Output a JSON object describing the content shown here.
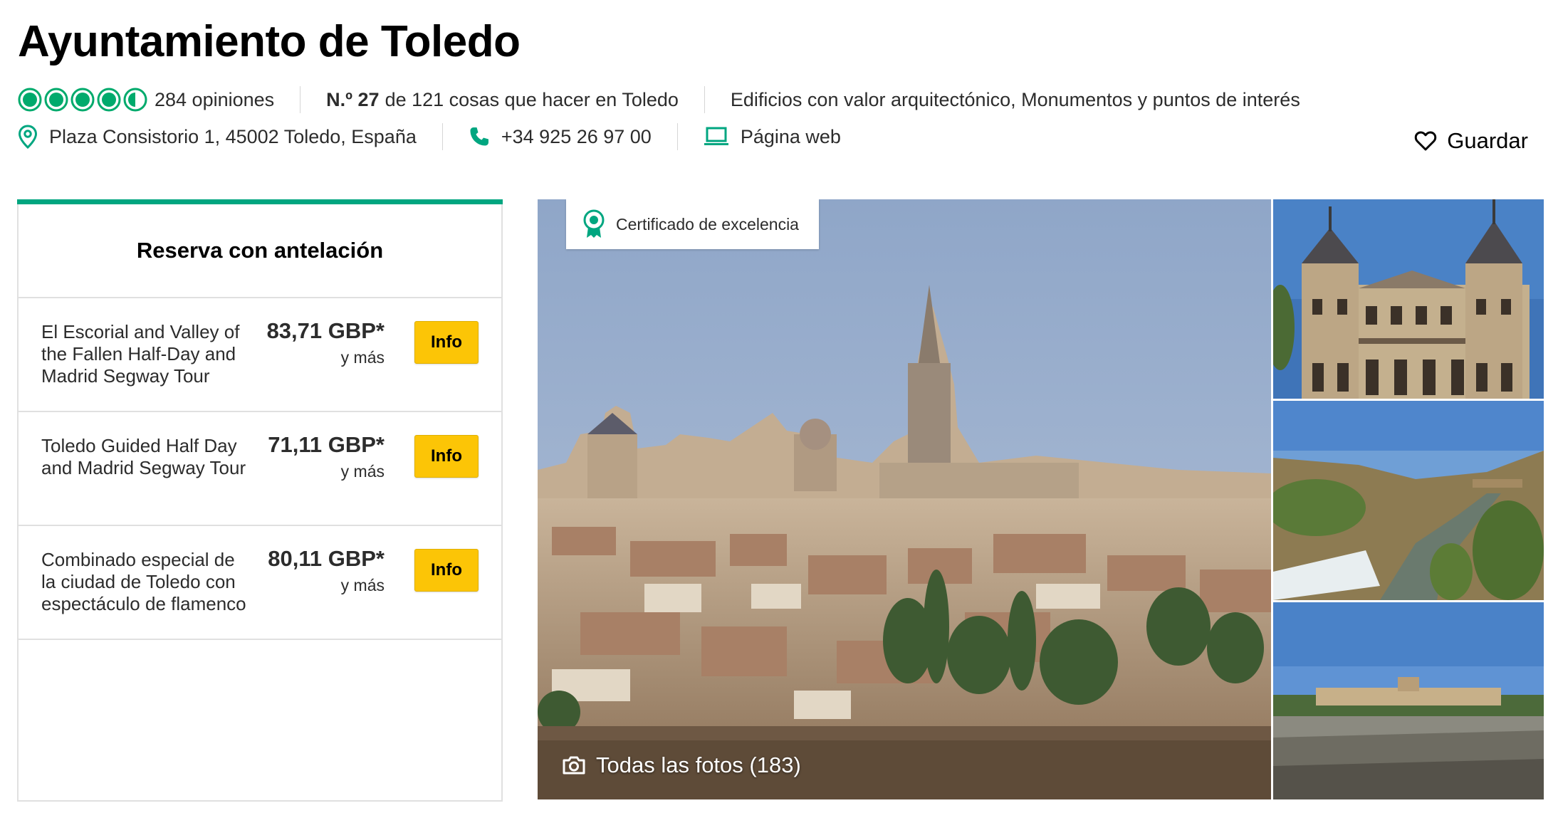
{
  "header": {
    "title": "Ayuntamiento de Toledo",
    "rating_bubbles": 4.5,
    "reviews": "284 opiniones",
    "rank_prefix": "N.º 27",
    "rank_rest": "de 121 cosas que hacer en Toledo",
    "categories": "Edificios con valor arquitectónico, Monumentos y puntos de interés",
    "address": "Plaza Consistorio 1, 45002 Toledo, España",
    "phone": "+34 925 26 97 00",
    "website": "Página web",
    "save": "Guardar"
  },
  "booking": {
    "title": "Reserva con antelación",
    "tours": [
      {
        "name": "El Escorial and Valley of the Fallen Half-Day and Madrid Segway Tour",
        "price": "83,71 GBP*",
        "suffix": "y más",
        "button": "Info"
      },
      {
        "name": "Toledo Guided Half Day and Madrid Segway Tour",
        "price": "71,11 GBP*",
        "suffix": "y más",
        "button": "Info"
      },
      {
        "name": "Combinado especial de la ciudad de Toledo con espectáculo de flamenco",
        "price": "80,11 GBP*",
        "suffix": "y más",
        "button": "Info"
      }
    ]
  },
  "photos": {
    "certificate": "Certificado de excelencia",
    "all_photos": "Todas las fotos (183)"
  },
  "colors": {
    "brand_green": "#00a680",
    "button_yellow": "#fcc506",
    "rating_green": "#00aa6c"
  }
}
